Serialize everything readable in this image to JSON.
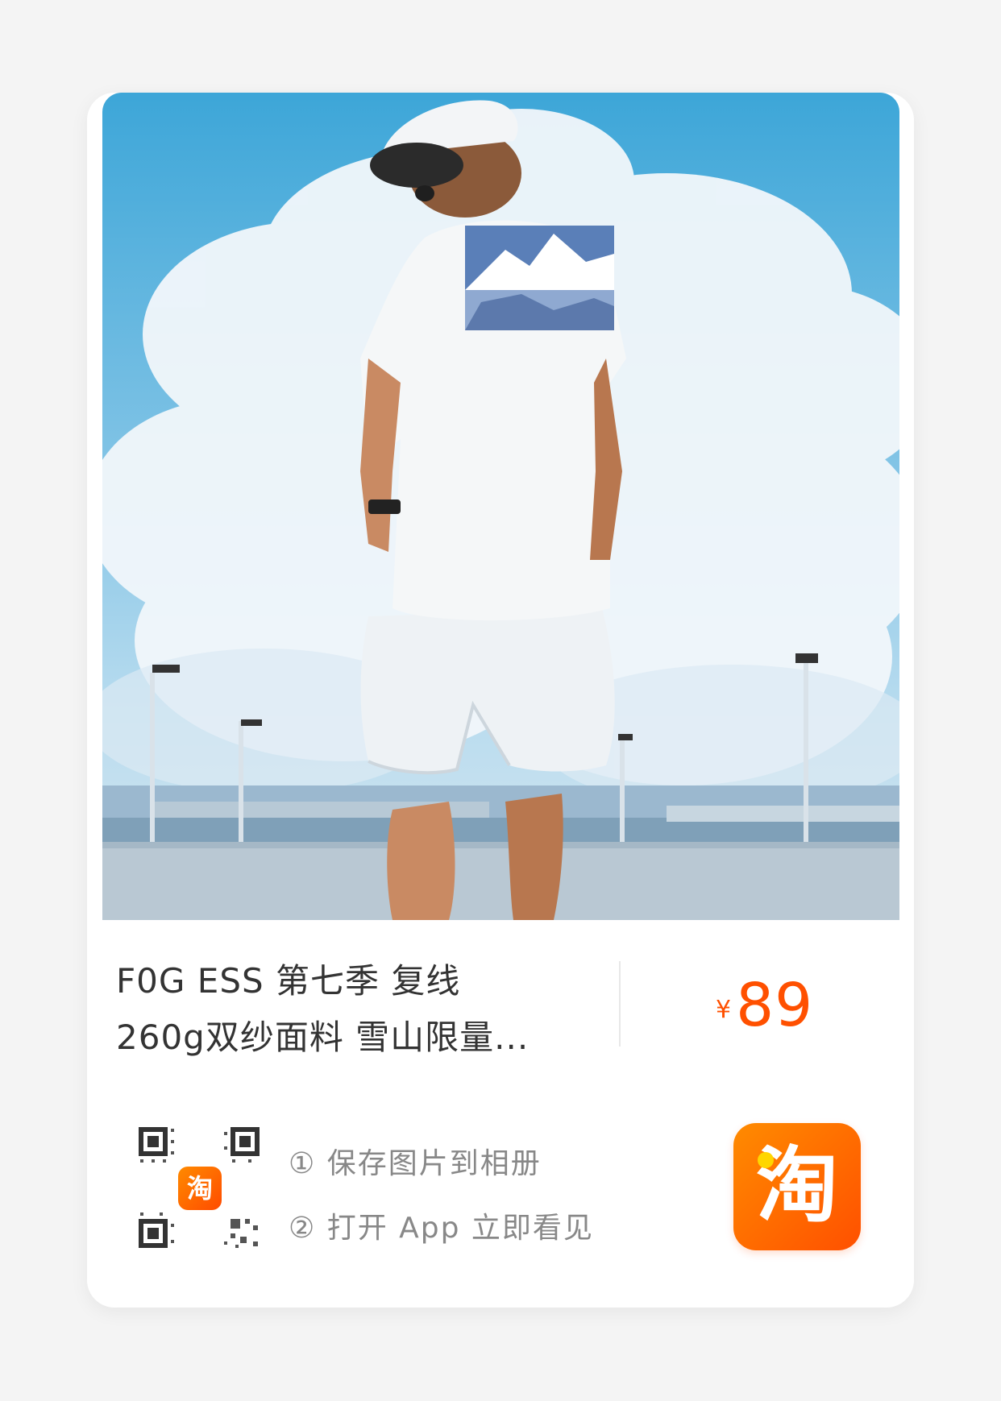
{
  "product": {
    "image_alt": "Man in white T-shirt with snowy mountain print standing on rooftop parking lot under blue sky",
    "title_line1": "F0G ESS 第七季 复线",
    "title_line2": "260g双纱面料 雪山限量...",
    "price_symbol": "¥",
    "price_value": "89"
  },
  "share": {
    "qr_badge": "淘",
    "step1": "① 保存图片到相册",
    "step2": "② 打开 App 立即看见",
    "app_icon_char": "淘"
  },
  "colors": {
    "accent": "#ff5000",
    "card_bg": "#ffffff",
    "page_bg": "#f4f4f4"
  },
  "icons": {
    "app": "taobao-app-icon",
    "qr": "qr-code-icon"
  }
}
